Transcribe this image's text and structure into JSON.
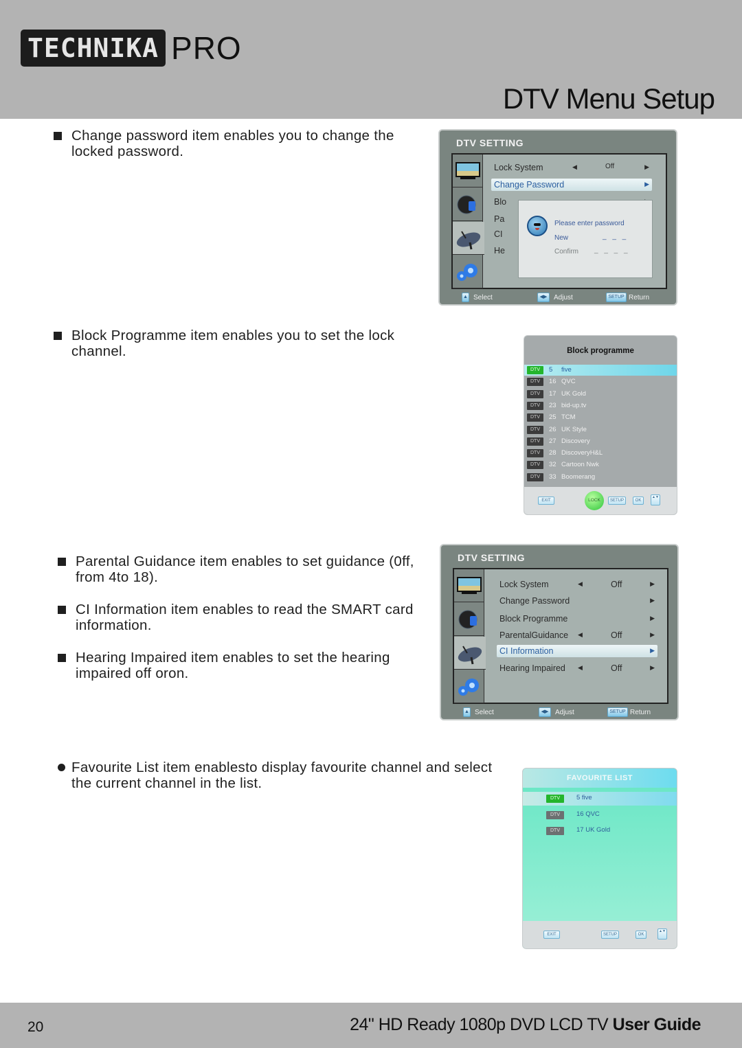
{
  "header": {
    "logo_main": "TECHNIKA",
    "logo_suffix": "PRO",
    "page_title": "DTV Menu Setup"
  },
  "paragraphs": {
    "change_password": "Change password item enables you to change the locked password.",
    "block_programme": "Block Programme item enables you to set the lock channel.",
    "parental_guidance": "Parental Guidance item enables to set guidance (0ff, from 4to 18).",
    "ci_information": "CI Information item enables to read the SMART card information.",
    "hearing_impaired": "Hearing Impaired item enables to set the hearing impaired off oron.",
    "favourite_list": "Favourite List item enablesto display favourite channel and select the current channel in the list."
  },
  "dtv_setting_1": {
    "title": "DTV SETTING",
    "side_tabs": [
      "picture-tv-icon",
      "sound-icon",
      "satellite-dish-icon",
      "settings-gears-icon"
    ],
    "active_tab": 2,
    "rows": [
      {
        "label": "Lock System",
        "value": "Off",
        "left_arrow": true
      },
      {
        "label": "Change Password",
        "value": "",
        "selected": true
      },
      {
        "label": "Blo",
        "value": ""
      },
      {
        "label": "Pa",
        "value": ""
      },
      {
        "label": "CI",
        "value": ""
      },
      {
        "label": "He",
        "value": ""
      }
    ],
    "dialog": {
      "message": "Please enter password",
      "new_label": "New",
      "new_value": "_ _ _",
      "confirm_label": "Confirm",
      "confirm_value": "_ _ _ _"
    },
    "footer": {
      "select": "Select",
      "adjust": "Adjust",
      "setup_key": "SETUP",
      "return": "Return"
    }
  },
  "block_programme": {
    "title": "Block programme",
    "channels": [
      {
        "type": "DTV",
        "number": "5",
        "name": "five",
        "selected": true
      },
      {
        "type": "DTV",
        "number": "16",
        "name": "QVC"
      },
      {
        "type": "DTV",
        "number": "17",
        "name": "UK Gold"
      },
      {
        "type": "DTV",
        "number": "23",
        "name": "bid-up.tv"
      },
      {
        "type": "DTV",
        "number": "25",
        "name": "TCM"
      },
      {
        "type": "DTV",
        "number": "26",
        "name": "UK Style"
      },
      {
        "type": "DTV",
        "number": "27",
        "name": "Discovery"
      },
      {
        "type": "DTV",
        "number": "28",
        "name": "DiscoveryH&L"
      },
      {
        "type": "DTV",
        "number": "32",
        "name": "Cartoon Nwk"
      },
      {
        "type": "DTV",
        "number": "33",
        "name": "Boomerang"
      }
    ],
    "buttons": {
      "exit": "EXIT",
      "lock": "LOCK",
      "setup": "SETUP",
      "ok": "OK",
      "updown": "▲▼"
    }
  },
  "dtv_setting_2": {
    "title": "DTV SETTING",
    "active_tab": 2,
    "rows": [
      {
        "label": "Lock System",
        "value": "Off",
        "left_arrow": true
      },
      {
        "label": "Change Password",
        "value": ""
      },
      {
        "label": "Block Programme",
        "value": ""
      },
      {
        "label": "ParentalGuidance",
        "value": "Off",
        "left_arrow": true
      },
      {
        "label": "CI Information",
        "value": "",
        "selected": true
      },
      {
        "label": "Hearing Impaired",
        "value": "Off",
        "left_arrow": true
      }
    ],
    "footer": {
      "select": "Select",
      "adjust": "Adjust",
      "setup_key": "SETUP",
      "return": "Return"
    }
  },
  "favourite_list": {
    "title": "FAVOURITE LIST",
    "channels": [
      {
        "type": "DTV",
        "name": "5 five",
        "selected": true
      },
      {
        "type": "DTV",
        "name": "16 QVC"
      },
      {
        "type": "DTV",
        "name": "17 UK Gold"
      }
    ],
    "buttons": {
      "exit": "EXIT",
      "setup": "SETUP",
      "ok": "OK",
      "updown": "▲▼"
    }
  },
  "footer": {
    "page_number": "20",
    "guide_title": "24\" HD Ready 1080p DVD LCD TV",
    "guide_suffix": "User Guide"
  },
  "colors": {
    "header_bg": "#b3b3b3",
    "panel_bg": "#7a8580",
    "selection_blue": "#2b5fa0",
    "dtv_tag_active": "#24b52c",
    "favourite_bg": "#66e6c4"
  }
}
